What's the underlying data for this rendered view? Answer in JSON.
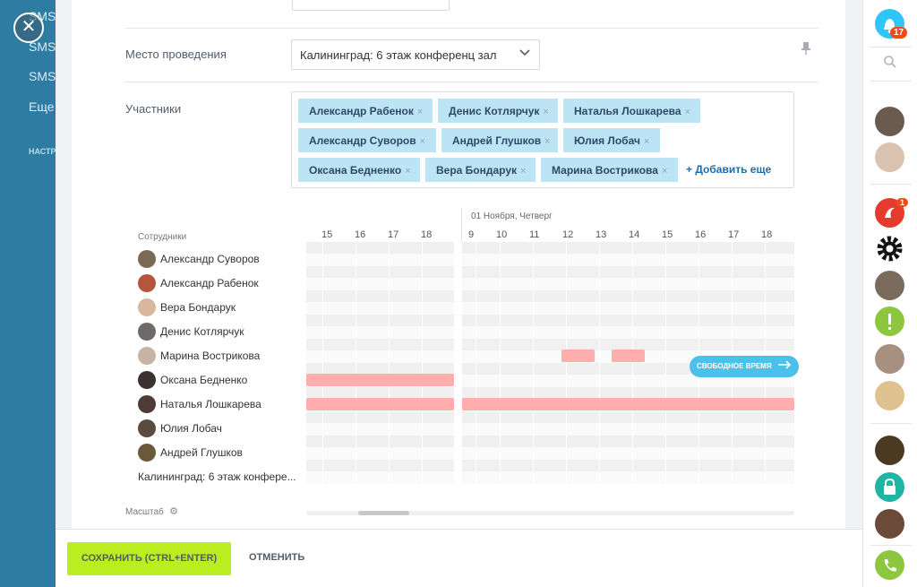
{
  "background_menu": {
    "items": [
      "SMS",
      "SMS",
      "SMS",
      "Еще"
    ],
    "section_label": "НАСТР"
  },
  "close_glyph": "✕",
  "form": {
    "place_label": "Место проведения",
    "place_value": "Калининград: 6 этаж конференц зал",
    "participants_label": "Участники",
    "participants": [
      "Александр Рабенок",
      "Денис Котлярчук",
      "Наталья Лошкарева",
      "Александр Суворов",
      "Андрей Глушков",
      "Юлия Лобач",
      "Оксана Бедненко",
      "Вера Бондарук",
      "Марина Вострикова"
    ],
    "tag_remove_glyph": "×",
    "add_more": "+ Добавить еще"
  },
  "planner": {
    "date_label": "01 Ноября, Четверг",
    "employees_header": "Сотрудники",
    "hours_prev": [
      "15",
      "16",
      "17",
      "18"
    ],
    "hours_day": [
      "9",
      "10",
      "11",
      "12",
      "13",
      "14",
      "15",
      "16",
      "17",
      "18"
    ],
    "employees": [
      "Александр Суворов",
      "Александр Рабенок",
      "Вера Бондарук",
      "Денис Котлярчук",
      "Марина Вострикова",
      "Оксана Бедненко",
      "Наталья Лошкарева",
      "Юлия Лобач",
      "Андрей Глушков"
    ],
    "room": "Калининград: 6 этаж конфере...",
    "free_time_label": "СВОБОДНОЕ ВРЕМЯ",
    "scale_label": "Масштаб"
  },
  "footer": {
    "save": "СОХРАНИТЬ (CTRL+ENTER)",
    "cancel": "ОТМЕНИТЬ"
  },
  "rightbar": {
    "notifications_count": "17",
    "app_badge_count": "1"
  },
  "colors": {
    "accent_green": "#bbed21",
    "tag_bg": "#bde4f5",
    "busy": "#ffadad",
    "free_time": "#4ac0ea",
    "notification": "#2fc6f6"
  }
}
